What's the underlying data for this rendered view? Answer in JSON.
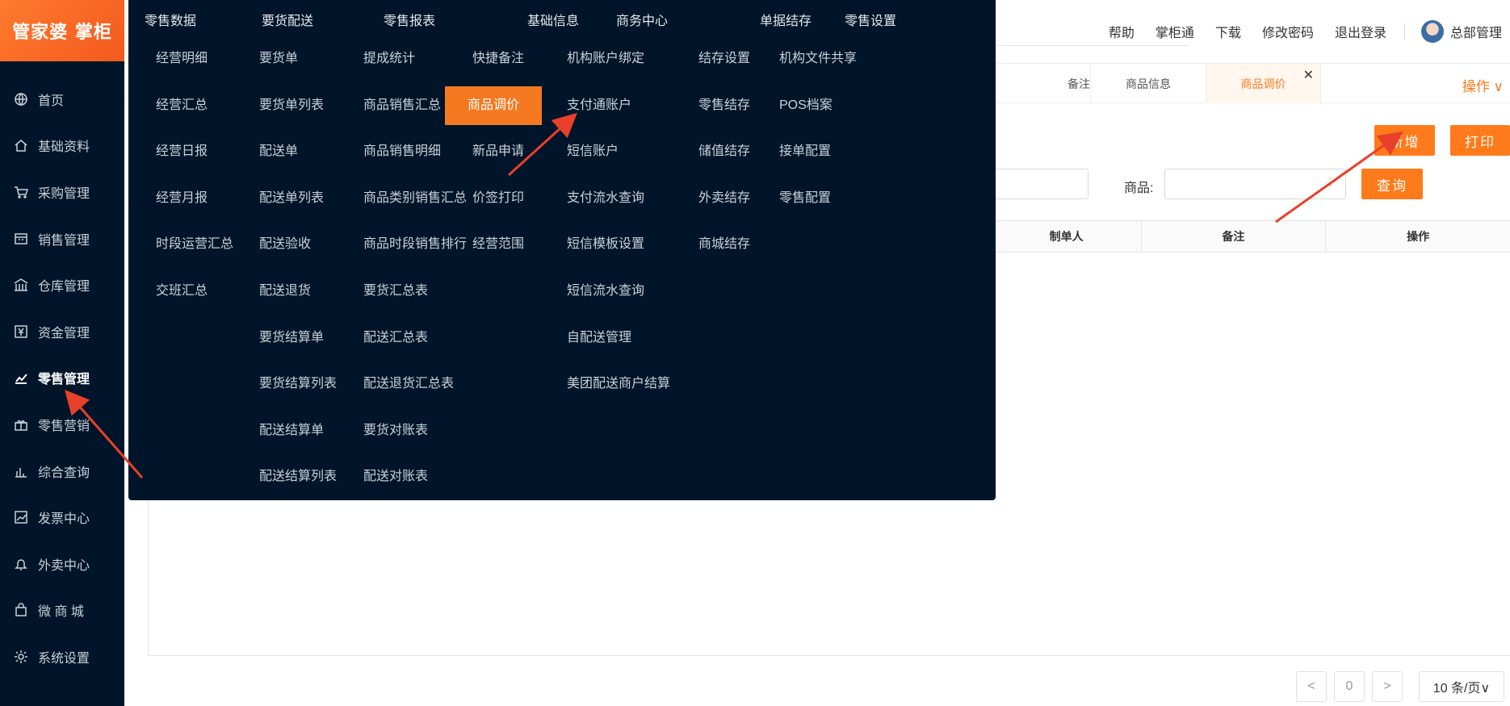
{
  "app": {
    "logo_text": "管家婆 掌柜"
  },
  "sidebar": {
    "items": [
      {
        "label": "首页",
        "icon": "globe-icon"
      },
      {
        "label": "基础资料",
        "icon": "home-icon"
      },
      {
        "label": "采购管理",
        "icon": "cart-icon"
      },
      {
        "label": "销售管理",
        "icon": "calendar-icon"
      },
      {
        "label": "仓库管理",
        "icon": "warehouse-icon"
      },
      {
        "label": "资金管理",
        "icon": "yen-icon"
      },
      {
        "label": "零售管理",
        "icon": "chart-icon",
        "active": true
      },
      {
        "label": "零售营销",
        "icon": "gift-icon"
      },
      {
        "label": "综合查询",
        "icon": "bar-chart-icon"
      },
      {
        "label": "发票中心",
        "icon": "trend-icon"
      },
      {
        "label": "外卖中心",
        "icon": "bell-icon"
      },
      {
        "label": "微 商 城",
        "icon": "bag-icon"
      },
      {
        "label": "系统设置",
        "icon": "gear-icon"
      }
    ]
  },
  "header": {
    "links": [
      "帮助",
      "掌柜通",
      "下载",
      "修改密码",
      "退出登录"
    ],
    "username": "总部管理"
  },
  "tabs": {
    "items": [
      "备注",
      "商品信息",
      "商品调价"
    ],
    "operations_label": "操作 ∨"
  },
  "toolbar": {
    "add_label": "新增",
    "print_label": "打印",
    "query_label": "查询"
  },
  "filter": {
    "product_label": "商品:"
  },
  "table": {
    "columns": [
      "制单人",
      "备注",
      "操作"
    ]
  },
  "pager": {
    "prev": "<",
    "page": "0",
    "next": ">",
    "page_size": "10 条/页∨"
  },
  "mega_menu": {
    "columns": [
      {
        "title": "零售数据",
        "items": [
          "经营明细",
          "经营汇总",
          "经营日报",
          "经营月报",
          "时段运营汇总",
          "交班汇总"
        ]
      },
      {
        "title": "要货配送",
        "items": [
          "要货单",
          "要货单列表",
          "配送单",
          "配送单列表",
          "配送验收",
          "配送退货",
          "要货结算单",
          "要货结算列表",
          "配送结算单",
          "配送结算列表"
        ]
      },
      {
        "title": "零售报表",
        "items": [
          "提成统计",
          "商品销售汇总",
          "商品销售明细",
          "商品类别销售汇总",
          "商品时段销售排行",
          "要货汇总表",
          "配送汇总表",
          "配送退货汇总表",
          "要货对账表",
          "配送对账表"
        ]
      },
      {
        "title": "基础信息",
        "items": [
          "快捷备注",
          "商品调价",
          "新品申请",
          "价签打印",
          "经营范围"
        ],
        "highlight_index": 1
      },
      {
        "title": "商务中心",
        "items": [
          "机构账户绑定",
          "支付通账户",
          "短信账户",
          "支付流水查询",
          "短信模板设置",
          "短信流水查询",
          "自配送管理",
          "美团配送商户结算"
        ]
      },
      {
        "title": "单据结存",
        "items": [
          "结存设置",
          "零售结存",
          "储值结存",
          "外卖结存",
          "商城结存"
        ]
      },
      {
        "title": "零售设置",
        "items": [
          "机构文件共享",
          "POS档案",
          "接单配置",
          "零售配置"
        ]
      }
    ]
  },
  "colors": {
    "accent": "#ff7a1a",
    "sidebar_bg": "#001529",
    "highlight": "#f47920"
  }
}
